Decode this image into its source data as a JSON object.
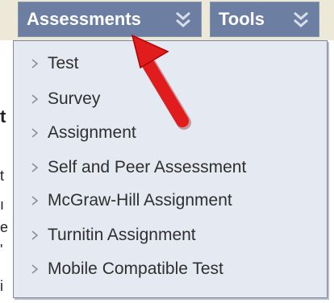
{
  "tabs": [
    {
      "label": "Assessments"
    },
    {
      "label": "Tools"
    }
  ],
  "menu": {
    "items": [
      {
        "label": "Test"
      },
      {
        "label": "Survey"
      },
      {
        "label": "Assignment"
      },
      {
        "label": "Self and Peer Assessment"
      },
      {
        "label": "McGraw-Hill Assignment"
      },
      {
        "label": "Turnitin Assignment"
      },
      {
        "label": "Mobile Compatible Test"
      }
    ]
  },
  "colors": {
    "tab_bg": "#6c7fa3",
    "menu_bg": "#e4e9f2",
    "pointer": "#e01c1c"
  }
}
